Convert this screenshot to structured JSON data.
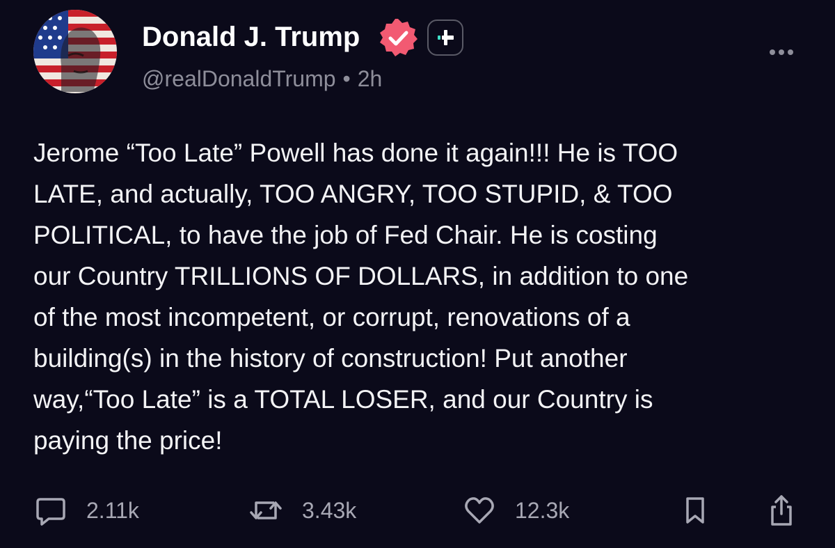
{
  "post": {
    "author": {
      "display_name": "Donald J. Trump",
      "handle": "@realDonaldTrump",
      "time_ago": "2h",
      "verified": true,
      "avatar_icon": "avatar-flag-portrait-icon"
    },
    "follow_button_icon": "plus-icon",
    "more_icon": "more-horizontal-icon",
    "text": "Jerome “Too Late” Powell has done it again!!! He is TOO\nLATE, and actually, TOO ANGRY, TOO STUPID, & TOO\nPOLITICAL, to have the job of Fed Chair. He is costing\nour Country TRILLIONS OF DOLLARS, in addition to one\nof the most incompetent, or corrupt, renovations of a\nbuilding(s) in the history of construction! Put another\nway,“Too Late” is a TOTAL LOSER, and our Country is\npaying the price!",
    "actions": {
      "replies": {
        "icon": "comment-icon",
        "count": "2.11k"
      },
      "reposts": {
        "icon": "repost-icon",
        "count": "3.43k"
      },
      "likes": {
        "icon": "heart-icon",
        "count": "12.3k"
      },
      "bookmark": {
        "icon": "bookmark-icon"
      },
      "share": {
        "icon": "share-icon"
      }
    }
  },
  "colors": {
    "background": "#0b0a1a",
    "text": "#f3f3f5",
    "muted": "#8e8e9a",
    "verified_badge": "#f25a72",
    "follow_accent": "#3fe0c8"
  }
}
